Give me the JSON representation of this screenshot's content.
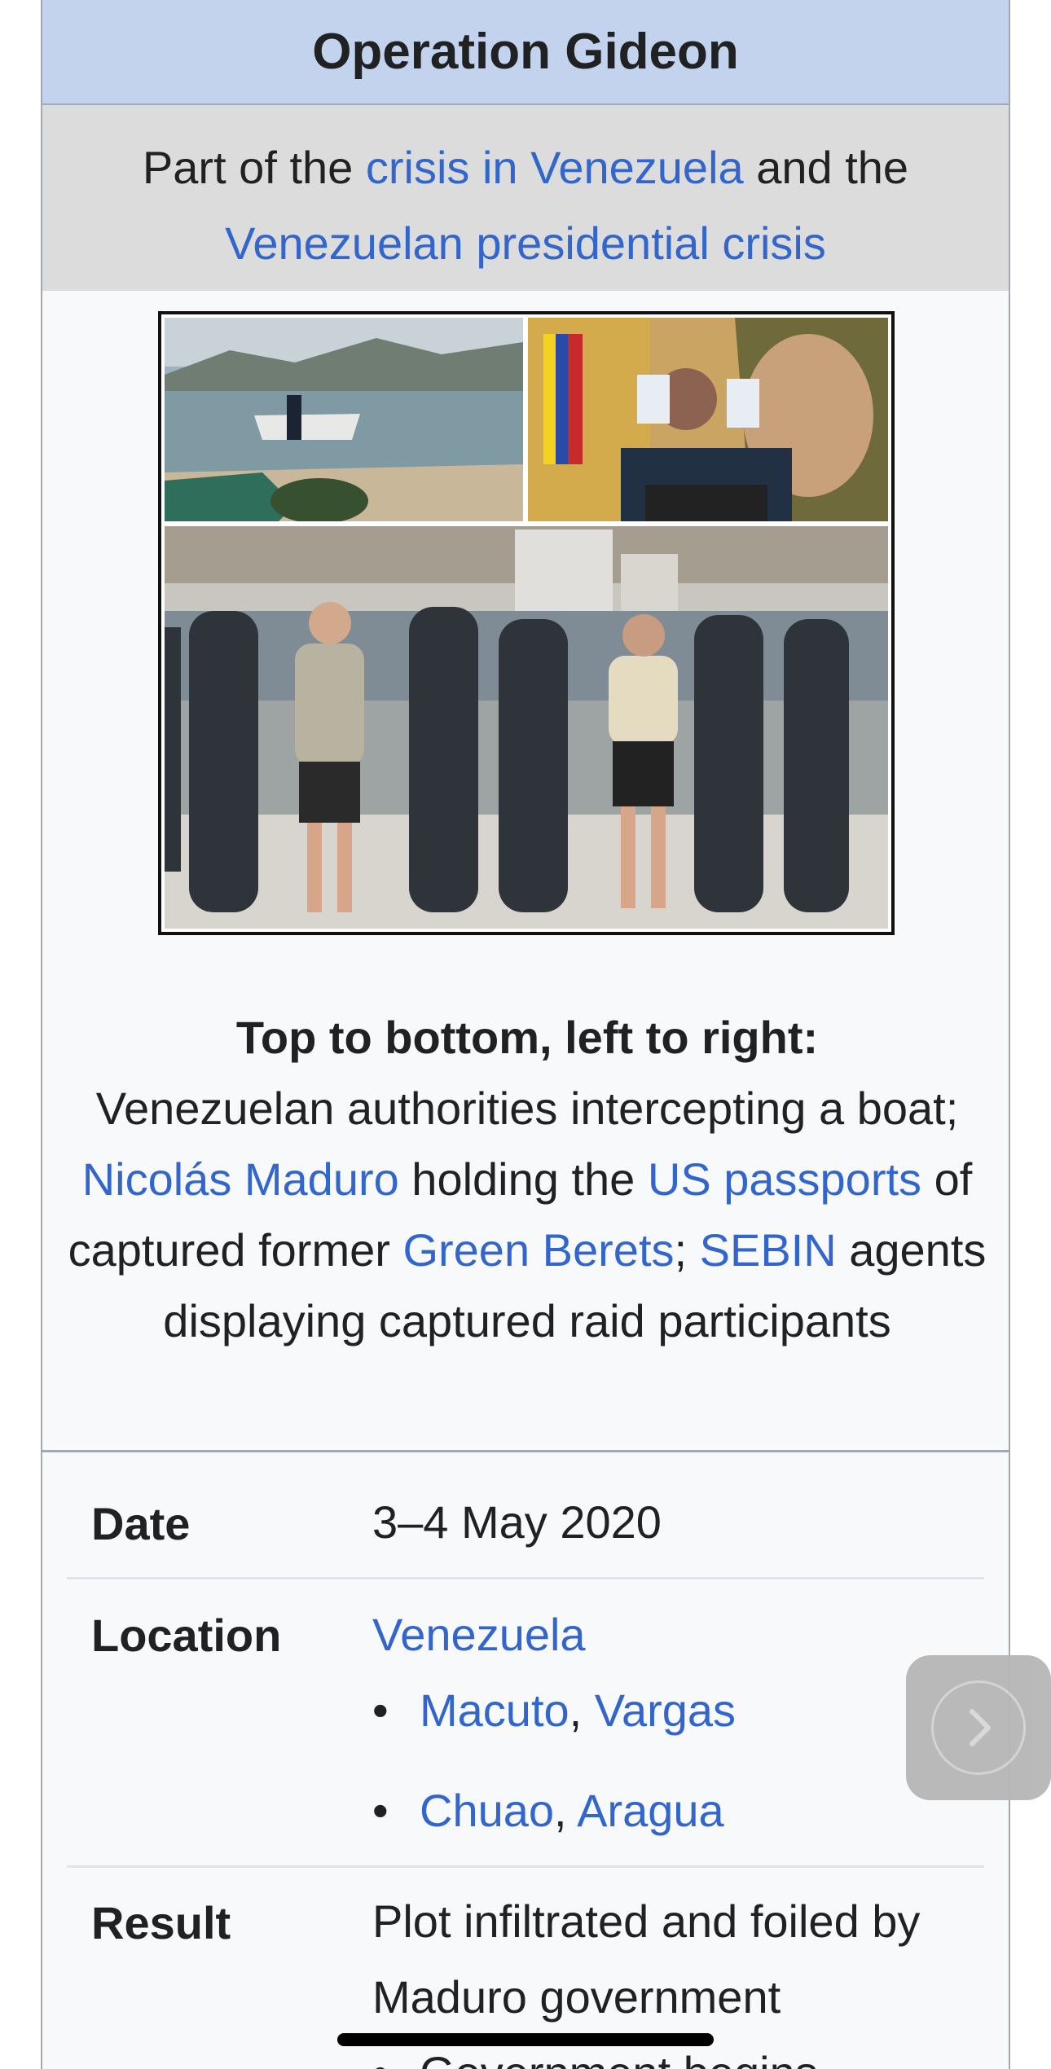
{
  "infobox": {
    "title": "Operation Gideon",
    "part_of": {
      "prefix": "Part of the ",
      "link1": "crisis in Venezuela",
      "middle": " and the",
      "link2": "Venezuelan presidential crisis"
    },
    "caption": {
      "bold": "Top to bottom, left to right:",
      "t1": " Venezuelan authorities intercepting a boat; ",
      "l1": "Nicolás Maduro",
      "t2": " holding the ",
      "l2": "US passports",
      "t3": " of captured former ",
      "l3": "Green Berets",
      "t4": "; ",
      "l4": "SEBIN",
      "t5": " agents displaying captured raid participants"
    },
    "rows": {
      "date": {
        "label": "Date",
        "value": "3–4 May 2020"
      },
      "location": {
        "label": "Location",
        "country": "Venezuela",
        "places": [
          {
            "town": "Macuto",
            "state": "Vargas"
          },
          {
            "town": "Chuao",
            "state": "Aragua"
          }
        ]
      },
      "result": {
        "label": "Result",
        "value": "Plot infiltrated and foiled by Maduro government",
        "next": "Government begins"
      }
    }
  },
  "nav": {
    "icon": "chevron-right-icon"
  },
  "colors": {
    "link": "#3366cc",
    "header": "#c3d3ee",
    "subheader": "#dcdcdc"
  }
}
